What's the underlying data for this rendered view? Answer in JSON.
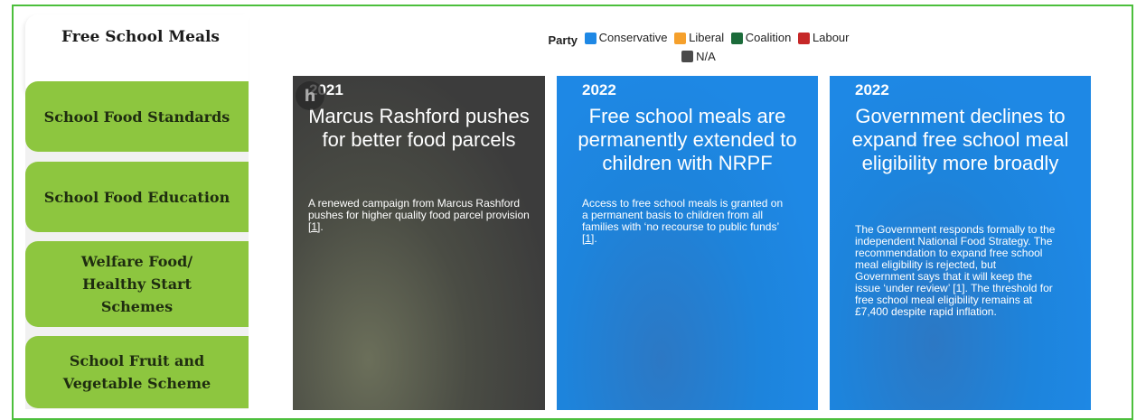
{
  "sidebar": {
    "active_title": "Free School Meals",
    "buttons": [
      {
        "label": "School Food Standards"
      },
      {
        "label": "School Food Education"
      },
      {
        "label": "Welfare Food/ Healthy Start Schemes"
      },
      {
        "label": "School Fruit and Vegetable Scheme"
      }
    ]
  },
  "legend": {
    "label": "Party",
    "items": [
      {
        "name": "Conservative",
        "color": "#1e88e5"
      },
      {
        "name": "Liberal",
        "color": "#f5a02c"
      },
      {
        "name": "Coalition",
        "color": "#1b6b3a"
      },
      {
        "name": "Labour",
        "color": "#c62828"
      },
      {
        "name": "N/A",
        "color": "#4a4a4a"
      }
    ]
  },
  "cards": [
    {
      "year": "2021",
      "party": "N/A",
      "color": "#555555",
      "title": "Marcus Rashford pushes for better food parcels",
      "text": "A renewed campaign from Marcus Rashford pushes for higher quality food parcel provision",
      "ref": "[1]",
      "suffix": "."
    },
    {
      "year": "2022",
      "party": "Conservative",
      "color": "#1e88e5",
      "title": "Free school meals are permanently extended to children with NRPF",
      "text": "Access to free school meals is granted on a permanent basis to children from all families with ‘no recourse to public funds’",
      "ref": "[1]",
      "suffix": "."
    },
    {
      "year": "2022",
      "party": "Conservative",
      "color": "#1e88e5",
      "title": "Government declines to expand free school meal eligibility more broadly",
      "text": "The Government responds formally to the independent National Food Strategy. The recommendation to expand free school meal eligibility is rejected, but Government says that it will keep the issue ‘under review’ [1]. The threshold for free school meal eligibility remains at £7,400 despite rapid inflation.",
      "ref": "",
      "suffix": ""
    }
  ],
  "icons": {
    "card_logo": "h-logo-icon"
  }
}
